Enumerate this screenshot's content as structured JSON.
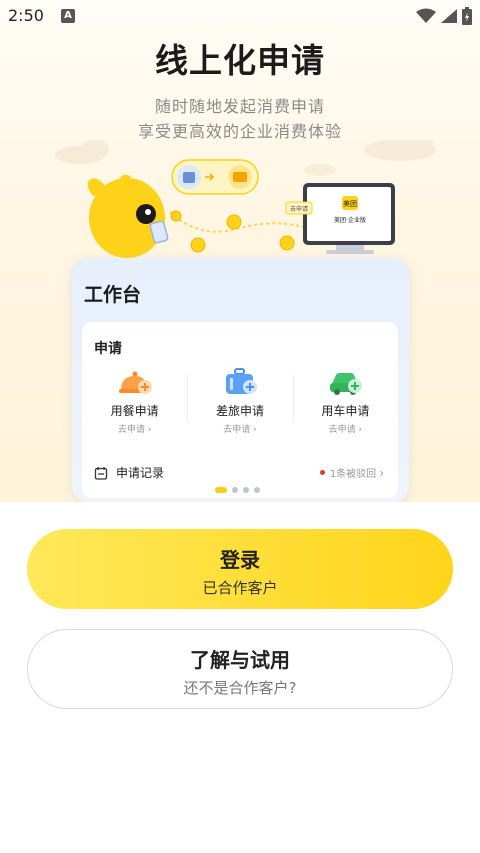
{
  "status_bar": {
    "time": "2:50",
    "notification_letter": "A"
  },
  "header": {
    "title": "线上化申请",
    "subtitle_line1": "随时随地发起消费申请",
    "subtitle_line2": "享受更高效的企业消费体验"
  },
  "illustration": {
    "tag_text": "去申请",
    "monitor_logo": "美团",
    "monitor_text": "美团·企业版"
  },
  "workbench": {
    "title": "工作台",
    "section_title": "申请",
    "apps": [
      {
        "label": "用餐申请",
        "action": "去申请 ›",
        "icon": "meal-bell-icon"
      },
      {
        "label": "差旅申请",
        "action": "去申请 ›",
        "icon": "travel-suitcase-icon"
      },
      {
        "label": "用车申请",
        "action": "去申请 ›",
        "icon": "car-icon"
      }
    ],
    "record_label": "申请记录",
    "reject_text": "1条被驳回",
    "reject_arrow": "›",
    "pager_active_index": 0,
    "pager_count": 4
  },
  "buttons": {
    "login_title": "登录",
    "login_subtitle": "已合作客户",
    "trial_title": "了解与试用",
    "trial_subtitle": "还不是合作客户?"
  },
  "colors": {
    "accent_yellow": "#ffd51a",
    "hero_bg": "#fff6e2",
    "card_bg": "#e6f0fb",
    "reject_dot": "#e53935"
  }
}
